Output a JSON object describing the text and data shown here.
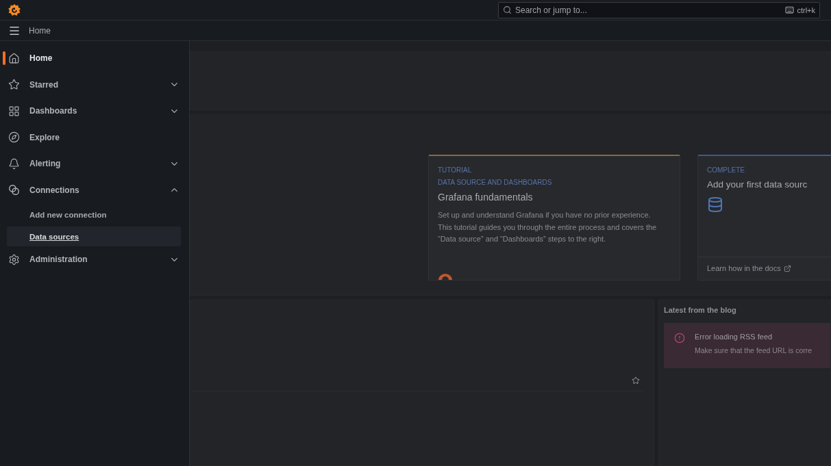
{
  "topbar": {
    "search": {
      "placeholder": "Search or jump to...",
      "shortcut": "ctrl+k"
    }
  },
  "breadcrumb": {
    "label": "Home"
  },
  "sidebar": {
    "items": [
      {
        "kind": "link",
        "label": "Home",
        "selected": true
      },
      {
        "kind": "group",
        "label": "Starred",
        "selected": false,
        "expanded": false
      },
      {
        "kind": "group",
        "label": "Dashboards",
        "selected": false,
        "expanded": false
      },
      {
        "kind": "link",
        "label": "Explore",
        "selected": false
      },
      {
        "kind": "group",
        "label": "Alerting",
        "selected": false,
        "expanded": false
      },
      {
        "kind": "group",
        "label": "Connections",
        "selected": false,
        "expanded": true,
        "children": [
          {
            "label": "Add new connection",
            "hovered": false
          },
          {
            "label": "Data sources",
            "hovered": true
          }
        ]
      },
      {
        "kind": "group",
        "label": "Administration",
        "selected": false,
        "expanded": false
      }
    ]
  },
  "cards": [
    {
      "kind": "tutorial",
      "tag": "TUTORIAL",
      "subtag": "DATA SOURCE AND DASHBOARDS",
      "title": "Grafana fundamentals",
      "text": "Set up and understand Grafana if you have no prior experience. This tutorial guides you through the entire process and covers the “Data source” and “Dashboards” steps to the right."
    },
    {
      "kind": "task",
      "tag": "COMPLETE",
      "title": "Add your first data sourc",
      "link": "Learn how in the docs"
    }
  ],
  "blog": {
    "title": "Latest from the blog",
    "error": {
      "title": "Error loading RSS feed",
      "text": "Make sure that the feed URL is corre"
    }
  }
}
